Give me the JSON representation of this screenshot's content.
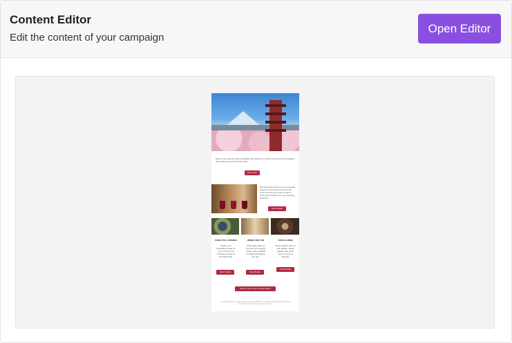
{
  "header": {
    "title": "Content Editor",
    "subtitle": "Edit the content of your campaign",
    "open_editor_label": "Open Editor"
  },
  "email": {
    "intro_text": "Enjoy it day-long any-period package that includes a variety of selected tour packages.\nAfter adult entry until the Plan Itinfo.",
    "book_now": "Book Now",
    "wine_text": "We have been known for our exquisite selection of wines from all over the world, and we are proud to have a plenty fine brands in our ever growing collection.",
    "view_details": "View details",
    "columns": [
      {
        "title": "SUSHI FULL EVENING",
        "text": "Chefs in our specialties all day on your of The Food Zoeshop Lounge at the Café Gate.",
        "button": "View Details"
      },
      {
        "title": "WINES AND FUN",
        "text": "Great value with our fine food and special menus, also available on tickets throughout the day.",
        "button": "View Details"
      },
      {
        "title": "TAPAS & WINE",
        "text": "Tapas platters! Here is your delight. Tapas platters with small fresh a menu & Sweets!",
        "button": "View Details"
      }
    ],
    "cta": "Click to view more exciting offers!",
    "footer": "You received this message because you have opted in to receiving communications from the restaurant. To unsubscribe, please click here."
  }
}
